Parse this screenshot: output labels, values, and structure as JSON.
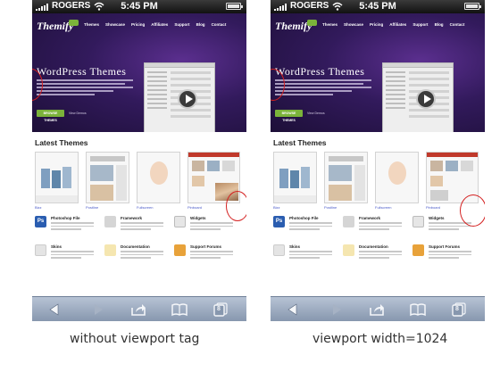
{
  "phones": [
    {
      "status": {
        "carrier": "ROGERS",
        "time": "5:45 PM"
      },
      "site": {
        "logo": "Themify",
        "nav": [
          "Themes",
          "Showcase",
          "Pricing",
          "Affiliates",
          "Support",
          "Blog",
          "Contact"
        ],
        "hero_title": "WordPress Themes",
        "browse_button": "BROWSE THEMES",
        "view_link": "View Demos",
        "latest_heading": "Latest Themes",
        "themes": [
          "Bizz",
          "Postline",
          "Fullscreen",
          "Pinboard"
        ],
        "features": [
          {
            "title": "Photoshop File",
            "icon": "photoshop-icon"
          },
          {
            "title": "Framework",
            "icon": "framework-icon"
          },
          {
            "title": "Widgets",
            "icon": "widgets-icon"
          },
          {
            "title": "Skins",
            "icon": "skins-icon"
          },
          {
            "title": "Documentation",
            "icon": "documentation-icon"
          },
          {
            "title": "Support Forums",
            "icon": "support-icon"
          }
        ]
      },
      "toolbar": {
        "pages_count": "8"
      },
      "caption": "without viewport tag"
    },
    {
      "status": {
        "carrier": "ROGERS",
        "time": "5:45 PM"
      },
      "site": {
        "logo": "Themify",
        "nav": [
          "Themes",
          "Showcase",
          "Pricing",
          "Affiliates",
          "Support",
          "Blog",
          "Contact"
        ],
        "hero_title": "WordPress Themes",
        "browse_button": "BROWSE THEMES",
        "view_link": "View Demos",
        "latest_heading": "Latest Themes",
        "themes": [
          "Bizz",
          "Postline",
          "Fullscreen",
          "Pinboard"
        ],
        "features": [
          {
            "title": "Photoshop File",
            "icon": "photoshop-icon"
          },
          {
            "title": "Framework",
            "icon": "framework-icon"
          },
          {
            "title": "Widgets",
            "icon": "widgets-icon"
          },
          {
            "title": "Skins",
            "icon": "skins-icon"
          },
          {
            "title": "Documentation",
            "icon": "documentation-icon"
          },
          {
            "title": "Support Forums",
            "icon": "support-icon"
          }
        ]
      },
      "toolbar": {
        "pages_count": "8"
      },
      "caption": "viewport width=1024"
    }
  ],
  "colors": {
    "hero_purple": "#321a5c",
    "accent_green": "#7bb33a",
    "highlight_red": "#d42020",
    "toolbar_blue": "#8797ae"
  }
}
